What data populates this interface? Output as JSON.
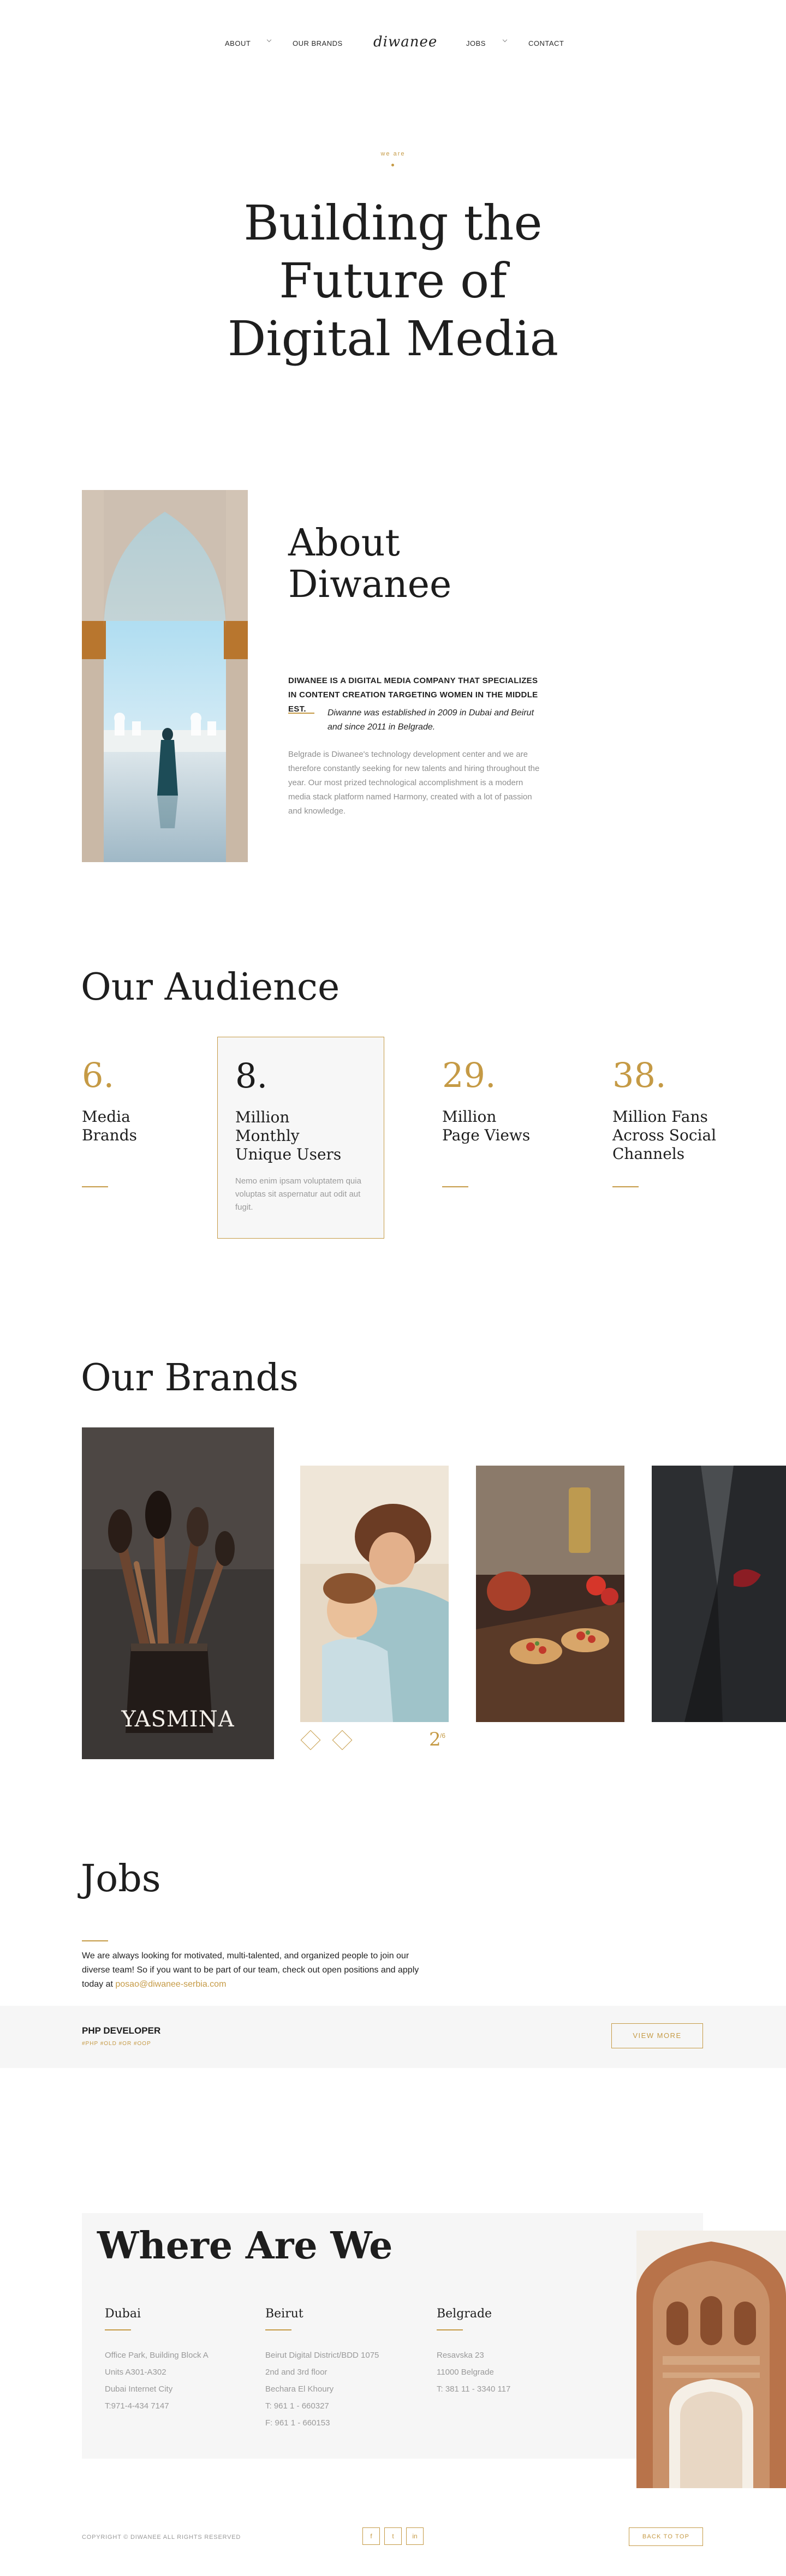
{
  "header": {
    "nav_left": [
      "ABOUT",
      "OUR BRANDS"
    ],
    "logo": "diwanee",
    "nav_right": [
      "JOBS",
      "CONTACT"
    ]
  },
  "hero": {
    "eyebrow": "we are",
    "title_lines": [
      "Building the",
      "Future of",
      "Digital Media"
    ]
  },
  "about": {
    "title_lines": [
      "About",
      "Diwanee"
    ],
    "lead": "DIWANEE IS A DIGITAL MEDIA COMPANY THAT SPECIALIZES IN CONTENT CREATION TARGETING WOMEN IN THE MIDDLE EST.",
    "italic": "Diwanne was established in 2009 in Dubai and Beirut and since 2011 in Belgrade.",
    "body": "Belgrade is Diwanee's technology development center and we are therefore constantly seeking for new talents and hiring throughout the year. Our most prized technological accomplishment is a modern media stack platform named Harmony, created with a lot of passion and knowledge."
  },
  "audience": {
    "title": "Our Audience",
    "stats": [
      {
        "num": "6.",
        "label": "Media\nBrands",
        "desc": ""
      },
      {
        "num": "8.",
        "label": "Million\nMonthly\nUnique Users",
        "desc": "Nemo enim ipsam voluptatem quia voluptas sit aspernatur aut odit aut fugit."
      },
      {
        "num": "29.",
        "label": "Million\nPage Views",
        "desc": ""
      },
      {
        "num": "38.",
        "label": "Million Fans\nAcross Social\nChannels",
        "desc": ""
      }
    ]
  },
  "brands": {
    "title": "Our Brands",
    "featured": "YASMINA",
    "current": "2",
    "total": "/6"
  },
  "jobs": {
    "title": "Jobs",
    "text_pre": "We are always looking for motivated, multi-talented, and organized people to join our diverse team! So if you want to be part of our team, check out open positions and apply today at ",
    "email": "posao@diwanee-serbia.com",
    "position": "PHP DEVELOPER",
    "tags": "#PHP #OLD #OR #OOP",
    "button": "VIEW MORE"
  },
  "where": {
    "title": "Where Are We",
    "offices": [
      {
        "city": "Dubai",
        "lines": [
          "Office Park, Building Block A",
          "Units A301-A302",
          "Dubai Internet City",
          "T:971-4-434 7147"
        ]
      },
      {
        "city": "Beirut",
        "lines": [
          "Beirut Digital District/BDD 1075",
          "2nd and 3rd floor",
          "Bechara El Khoury",
          "T: 961 1 - 660327",
          "F: 961 1 - 660153"
        ]
      },
      {
        "city": "Belgrade",
        "lines": [
          "Resavska 23",
          "11000 Belgrade",
          "T: 381 11 - 3340 117"
        ]
      }
    ]
  },
  "footer": {
    "copyright": "COPYRIGHT © DIWANEE ALL RIGHTS RESERVED",
    "social": [
      "f",
      "t",
      "in"
    ],
    "top_button": "BACK TO TOP"
  }
}
